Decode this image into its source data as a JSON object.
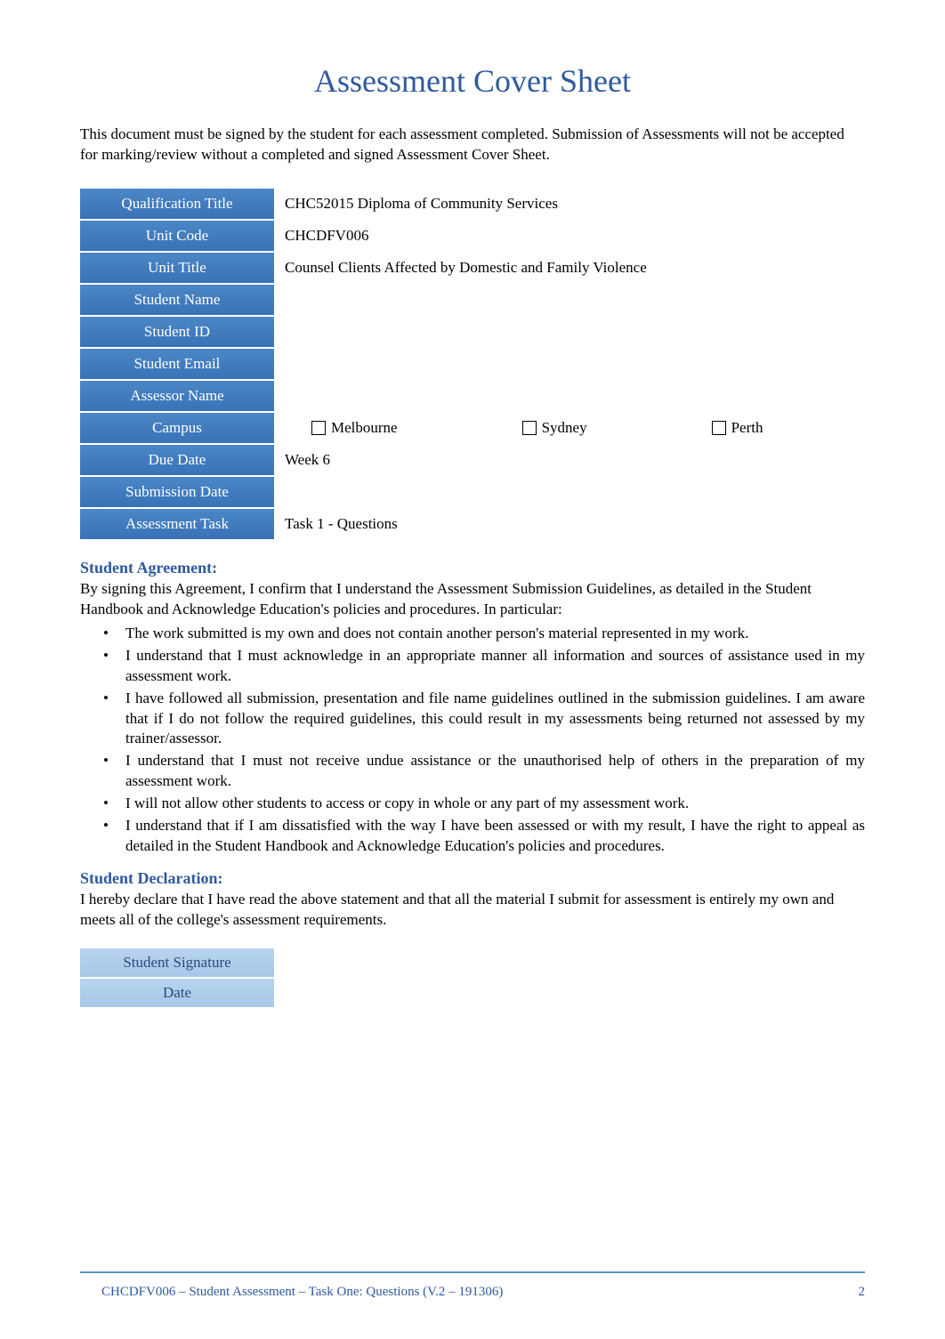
{
  "title": "Assessment Cover Sheet",
  "intro": "This document must be signed by the student for each assessment completed. Submission of Assessments will not be accepted for marking/review without a completed and signed Assessment Cover Sheet.",
  "table": {
    "qualification_title": {
      "label": "Qualification Title",
      "value": "CHC52015 Diploma of Community Services"
    },
    "unit_code": {
      "label": "Unit Code",
      "value": "CHCDFV006"
    },
    "unit_title": {
      "label": "Unit Title",
      "value": "Counsel Clients Affected by Domestic and Family Violence"
    },
    "student_name": {
      "label": "Student Name",
      "value": ""
    },
    "student_id": {
      "label": "Student ID",
      "value": ""
    },
    "student_email": {
      "label": "Student Email",
      "value": ""
    },
    "assessor_name": {
      "label": "Assessor Name",
      "value": ""
    },
    "campus": {
      "label": "Campus",
      "options": [
        "Melbourne",
        "Sydney",
        "Perth"
      ]
    },
    "due_date": {
      "label": "Due Date",
      "value": "Week 6"
    },
    "submission_date": {
      "label": "Submission Date",
      "value": ""
    },
    "assessment_task": {
      "label": "Assessment Task",
      "value": "Task 1 - Questions"
    }
  },
  "agreement": {
    "heading": "Student Agreement:",
    "intro": "By signing this Agreement, I confirm that I understand the Assessment Submission Guidelines, as detailed in the Student Handbook and Acknowledge Education's policies and procedures. In particular:",
    "items": [
      "The work submitted is my own and does not contain another person's material represented in my work.",
      "I understand that I must acknowledge in an appropriate manner all information and sources of assistance used in my assessment work.",
      "I have followed all submission, presentation and file name guidelines outlined in the submission guidelines. I am aware that if I do not follow the required guidelines, this could result in my assessments being returned not assessed by my trainer/assessor.",
      "I understand that I must not receive undue assistance or the unauthorised help of others in the preparation of my assessment work.",
      "I will not allow other students to access or copy in whole or any part of my assessment work.",
      "I understand that if I am dissatisfied with the way I have been assessed or with my result, I have the right to appeal as detailed in the Student Handbook and Acknowledge Education's policies and procedures."
    ]
  },
  "declaration": {
    "heading": "Student Declaration:",
    "text": "I hereby declare that I have read the above statement and that all the material I submit for assessment is entirely my own and meets all of the college's assessment requirements."
  },
  "signature": {
    "student_signature": {
      "label": "Student Signature",
      "value": ""
    },
    "date": {
      "label": "Date",
      "value": ""
    }
  },
  "footer": {
    "left": "CHCDFV006 – Student Assessment – Task One: Questions (V.2 – 191306)",
    "page": "2"
  }
}
